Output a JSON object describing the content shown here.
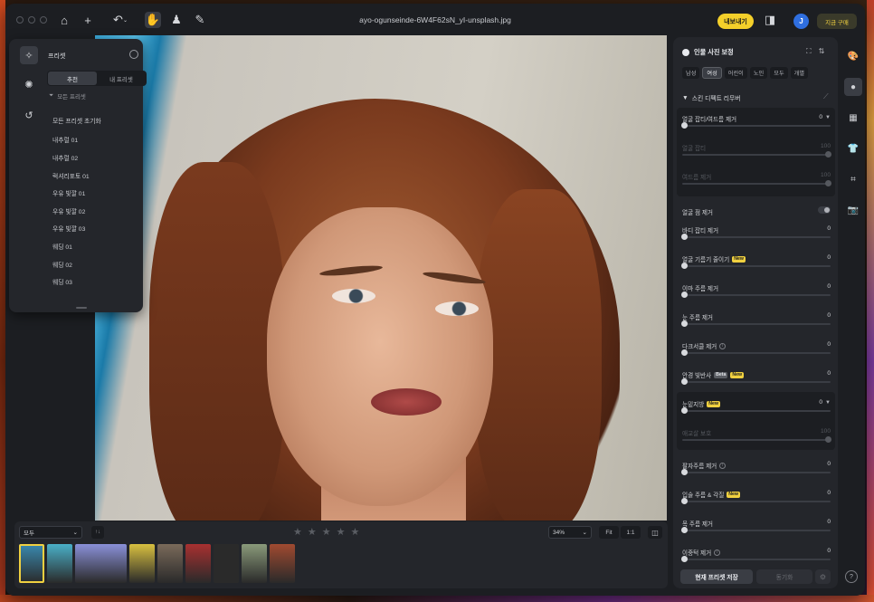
{
  "titlebar": {
    "document_title": "ayo-ogunseinde-6W4F62sN_yI-unsplash.jpg",
    "export_label": "내보내기",
    "avatar_initial": "J",
    "buy_label": "지금 구매",
    "icons": [
      "home-icon",
      "plus-icon",
      "undo-icon",
      "hand-icon",
      "stamp-icon",
      "bandage-icon",
      "sidebar-toggle-icon"
    ]
  },
  "preset_panel": {
    "title": "프리셋",
    "tabs": [
      {
        "label": "추천",
        "active": true
      },
      {
        "label": "내 프리셋",
        "active": false
      }
    ],
    "filter_label": "모든 프리셋",
    "items": [
      "모든 프리셋 초기화",
      "내추럴 01",
      "내추럴 02",
      "럭셔리포토 01",
      "우유 빛깔 01",
      "우유 빛깔 02",
      "우유 빛깔 03",
      "웨딩 01",
      "웨딩 02",
      "웨딩 03"
    ]
  },
  "filmstrip": {
    "filter_value": "모두",
    "sort_label": "↑↓",
    "rating_stars": 5,
    "zoom_value": "34%",
    "fit_label": "Fit",
    "one_to_one_label": "1:1",
    "thumbnails": [
      {
        "selected": true,
        "color": "#3a8ab0"
      },
      {
        "selected": false,
        "color": "#4ab0c8"
      },
      {
        "selected": false,
        "color": "#8a90d8",
        "wide": true
      },
      {
        "selected": false,
        "color": "#d8c040"
      },
      {
        "selected": false,
        "color": "#7a6a5a"
      },
      {
        "selected": false,
        "color": "#a83030"
      },
      {
        "selected": false,
        "color": "#2a2a2a"
      },
      {
        "selected": false,
        "color": "#8a9a7a"
      },
      {
        "selected": false,
        "color": "#a04a30"
      }
    ]
  },
  "adjustments": {
    "title": "인물 사진 보정",
    "category_tabs": [
      {
        "label": "남성",
        "active": false
      },
      {
        "label": "여성",
        "active": true
      },
      {
        "label": "어린이",
        "active": false
      },
      {
        "label": "노인",
        "active": false
      },
      {
        "label": "모두",
        "active": false
      },
      {
        "label": "개별",
        "active": false
      }
    ],
    "section_title": "스킨 디펙트 리무버",
    "controls": {
      "blemish": {
        "label": "얼굴 잡티/여드름 제거",
        "value": "0"
      },
      "blemish_sub1": {
        "label": "얼굴 잡티",
        "value": "100"
      },
      "blemish_sub2": {
        "label": "여드름 제거",
        "value": "100"
      },
      "mole": {
        "label": "얼굴 점 제거"
      },
      "body_blemish": {
        "label": "바디 잡티 제거",
        "value": "0"
      },
      "oil": {
        "label": "얼굴 기름기 줄이기",
        "value": "0",
        "badge": "New"
      },
      "forehead": {
        "label": "이마 주름 제거",
        "value": "0"
      },
      "eye_wrinkle": {
        "label": "눈 주름 제거",
        "value": "0"
      },
      "dark_circle": {
        "label": "다크서클 제거",
        "value": "0"
      },
      "glasses": {
        "label": "안경 빛반사",
        "value": "0",
        "badge_beta": "Beta",
        "badge_new": "New"
      },
      "under_eye": {
        "label": "눈밑지방",
        "value": "0",
        "badge": "New"
      },
      "under_eye_sub": {
        "label": "애교살 보호",
        "value": "100"
      },
      "crows": {
        "label": "팔자주름 제거",
        "value": "0"
      },
      "lip": {
        "label": "입술 주름 & 각질",
        "value": "0",
        "badge": "New"
      },
      "neck": {
        "label": "목 주름 제거",
        "value": "0"
      },
      "double_chin": {
        "label": "이중턱 제거",
        "value": "0"
      }
    },
    "save_preset_label": "현재 프리셋 저장",
    "sync_label": "동기화"
  }
}
